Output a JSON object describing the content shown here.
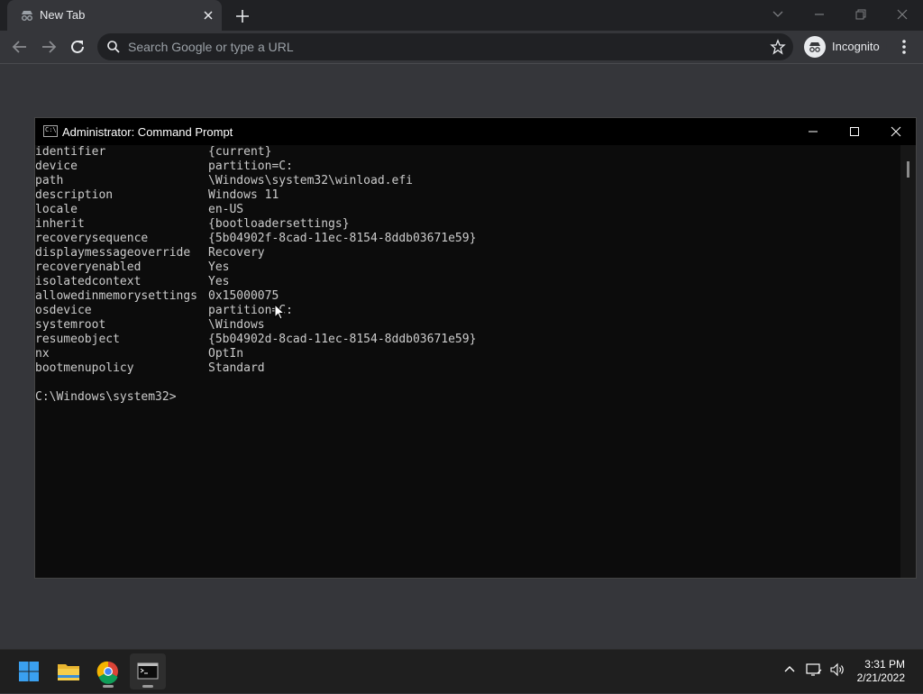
{
  "browser": {
    "tab_title": "New Tab",
    "omnibox_placeholder": "Search Google or type a URL",
    "incognito_label": "Incognito",
    "icons": [
      "incognito-icon",
      "close-icon",
      "plus-icon",
      "back-icon",
      "forward-icon",
      "reload-icon",
      "search-icon",
      "star-icon",
      "kebab-menu-icon",
      "chevron-down-icon",
      "minimize-icon",
      "restore-icon"
    ]
  },
  "cmd": {
    "title": "Administrator: Command Prompt",
    "icon_text": "C:\\",
    "lines": [
      {
        "key": "identifier",
        "value": "{current}"
      },
      {
        "key": "device",
        "value": "partition=C:"
      },
      {
        "key": "path",
        "value": "\\Windows\\system32\\winload.efi"
      },
      {
        "key": "description",
        "value": "Windows 11"
      },
      {
        "key": "locale",
        "value": "en-US"
      },
      {
        "key": "inherit",
        "value": "{bootloadersettings}"
      },
      {
        "key": "recoverysequence",
        "value": "{5b04902f-8cad-11ec-8154-8ddb03671e59}"
      },
      {
        "key": "displaymessageoverride",
        "value": "Recovery"
      },
      {
        "key": "recoveryenabled",
        "value": "Yes"
      },
      {
        "key": "isolatedcontext",
        "value": "Yes"
      },
      {
        "key": "allowedinmemorysettings",
        "value": "0x15000075"
      },
      {
        "key": "osdevice",
        "value": "partition=C:"
      },
      {
        "key": "systemroot",
        "value": "\\Windows"
      },
      {
        "key": "resumeobject",
        "value": "{5b04902d-8cad-11ec-8154-8ddb03671e59}"
      },
      {
        "key": "nx",
        "value": "OptIn"
      },
      {
        "key": "bootmenupolicy",
        "value": "Standard"
      }
    ],
    "prompt": "C:\\Windows\\system32>"
  },
  "taskbar": {
    "apps": [
      "windows-start-icon",
      "file-explorer-icon",
      "chrome-icon",
      "terminal-icon"
    ],
    "time": "3:31 PM",
    "date": "2/21/2022"
  }
}
